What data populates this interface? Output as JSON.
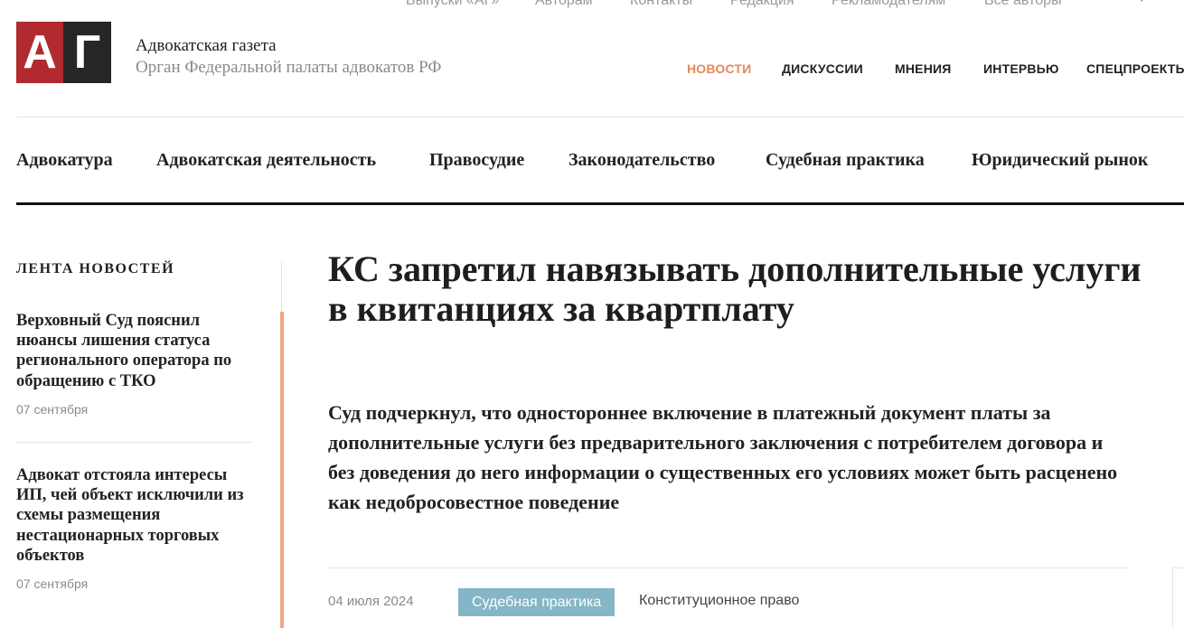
{
  "top_nav": {
    "items": [
      "Выпуски «АГ»",
      "Авторам",
      "Контакты",
      "Редакция",
      "Рекламодателям",
      "Все авторы"
    ]
  },
  "logo": {
    "letter1": "А",
    "letter2": "Г"
  },
  "site": {
    "name": "Адвокатская газета",
    "subtitle": "Орган Федеральной палаты адвокатов РФ"
  },
  "main_nav": {
    "items": [
      "НОВОСТИ",
      "ДИСКУССИИ",
      "МНЕНИЯ",
      "ИНТЕРВЬЮ",
      "СПЕЦПРОЕКТЫ"
    ],
    "active_index": 0
  },
  "category_nav": {
    "items": [
      "Адвокатура",
      "Адвокатская деятельность",
      "Правосудие",
      "Законодательство",
      "Судебная практика",
      "Юридический рынок"
    ]
  },
  "sidebar": {
    "title": "ЛЕНТА НОВОСТЕЙ",
    "news": [
      {
        "title": "Верховный Суд пояснил нюансы лишения статуса регионального оператора по обращению с ТКО",
        "date": "07 сентября"
      },
      {
        "title": "Адвокат отстояла интересы ИП, чей объект исключили из схемы размещения нестационарных торговых объектов",
        "date": "07 сентября"
      }
    ]
  },
  "article": {
    "title": "КС запретил навязывать дополнительные услуги в квитанциях за квартплату",
    "lead": "Суд подчеркнул, что одностороннее включение в платежный документ платы за дополнительные услуги без предварительного заключения с потребителем договора и без доведения до него информации о существенных его условиях может быть расценено как недобросовестное поведение",
    "date": "04 июля 2024",
    "category": "Судебная практика",
    "tag": "Конституционное право"
  },
  "colors": {
    "logo_red": "#b02a30",
    "logo_dark": "#262626",
    "active_nav": "#e8875c",
    "sidebar_accent": "#f0a884",
    "badge": "#85b6c5"
  },
  "icons": {
    "search": "search-icon"
  }
}
